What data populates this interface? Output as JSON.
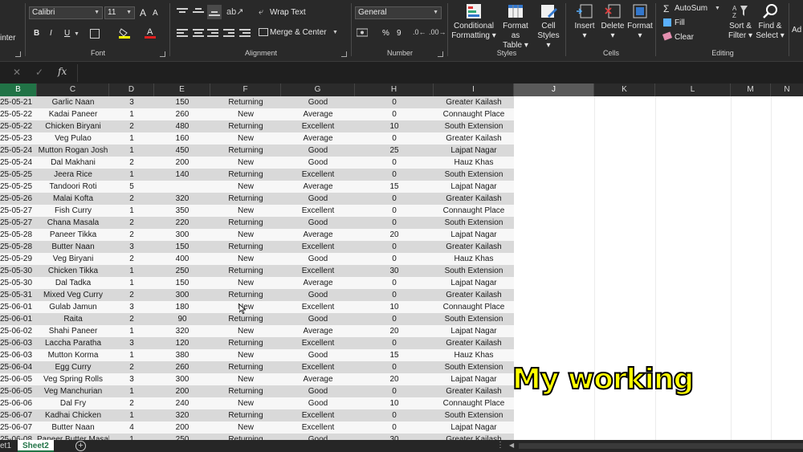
{
  "ribbon": {
    "clipboard_partial": "inter",
    "font": {
      "name": "Calibri",
      "size": "11",
      "grow_label": "A",
      "shrink_label": "A",
      "bold": "B",
      "italic": "I",
      "underline": "U",
      "group_label": "Font"
    },
    "alignment": {
      "wrap_text": "Wrap Text",
      "merge_center": "Merge & Center",
      "group_label": "Alignment"
    },
    "number": {
      "format": "General",
      "percent": "%",
      "comma": "9",
      "group_label": "Number"
    },
    "styles": {
      "conditional_formatting": [
        "Conditional",
        "Formatting"
      ],
      "format_as_table": [
        "Format as",
        "Table"
      ],
      "cell_styles": [
        "Cell",
        "Styles"
      ],
      "group_label": "Styles"
    },
    "cells": {
      "insert": "Insert",
      "delete": "Delete",
      "format": "Format",
      "group_label": "Cells"
    },
    "editing": {
      "autosum": "AutoSum",
      "fill": "Fill",
      "clear": "Clear",
      "sort_filter": [
        "Sort &",
        "Filter"
      ],
      "find_select": [
        "Find &",
        "Select"
      ],
      "group_label": "Editing"
    },
    "addins_partial": "Ad"
  },
  "formula_bar": {
    "fx": "fx"
  },
  "columns": [
    "B",
    "C",
    "D",
    "E",
    "F",
    "G",
    "H",
    "I",
    "J",
    "K",
    "L",
    "M",
    "N"
  ],
  "rows": [
    [
      "25-05-21",
      "Garlic Naan",
      "3",
      "150",
      "Returning",
      "Good",
      "0",
      "Greater Kailash"
    ],
    [
      "25-05-22",
      "Kadai Paneer",
      "1",
      "260",
      "New",
      "Average",
      "0",
      "Connaught Place"
    ],
    [
      "25-05-22",
      "Chicken Biryani",
      "2",
      "480",
      "Returning",
      "Excellent",
      "10",
      "South Extension"
    ],
    [
      "25-05-23",
      "Veg Pulao",
      "1",
      "160",
      "New",
      "Average",
      "0",
      "Greater Kailash"
    ],
    [
      "25-05-24",
      "Mutton Rogan Josh",
      "1",
      "450",
      "Returning",
      "Good",
      "25",
      "Lajpat Nagar"
    ],
    [
      "25-05-24",
      "Dal Makhani",
      "2",
      "200",
      "New",
      "Good",
      "0",
      "Hauz Khas"
    ],
    [
      "25-05-25",
      "Jeera Rice",
      "1",
      "140",
      "Returning",
      "Excellent",
      "0",
      "South Extension"
    ],
    [
      "25-05-25",
      "Tandoori Roti",
      "5",
      "",
      "New",
      "Average",
      "15",
      "Lajpat Nagar"
    ],
    [
      "25-05-26",
      "Malai Kofta",
      "2",
      "320",
      "Returning",
      "Good",
      "0",
      "Greater Kailash"
    ],
    [
      "25-05-27",
      "Fish Curry",
      "1",
      "350",
      "New",
      "Excellent",
      "0",
      "Connaught Place"
    ],
    [
      "25-05-27",
      "Chana Masala",
      "2",
      "220",
      "Returning",
      "Good",
      "0",
      "South Extension"
    ],
    [
      "25-05-28",
      "Paneer Tikka",
      "2",
      "300",
      "New",
      "Average",
      "20",
      "Lajpat Nagar"
    ],
    [
      "25-05-28",
      "Butter Naan",
      "3",
      "150",
      "Returning",
      "Excellent",
      "0",
      "Greater Kailash"
    ],
    [
      "25-05-29",
      "Veg Biryani",
      "2",
      "400",
      "New",
      "Good",
      "0",
      "Hauz Khas"
    ],
    [
      "25-05-30",
      "Chicken Tikka",
      "1",
      "250",
      "Returning",
      "Excellent",
      "30",
      "South Extension"
    ],
    [
      "25-05-30",
      "Dal Tadka",
      "1",
      "150",
      "New",
      "Average",
      "0",
      "Lajpat Nagar"
    ],
    [
      "25-05-31",
      "Mixed Veg Curry",
      "2",
      "300",
      "Returning",
      "Good",
      "0",
      "Greater Kailash"
    ],
    [
      "25-06-01",
      "Gulab Jamun",
      "3",
      "180",
      "New",
      "Excellent",
      "10",
      "Connaught Place"
    ],
    [
      "25-06-01",
      "Raita",
      "2",
      "90",
      "Returning",
      "Good",
      "0",
      "South Extension"
    ],
    [
      "25-06-02",
      "Shahi Paneer",
      "1",
      "320",
      "New",
      "Average",
      "20",
      "Lajpat Nagar"
    ],
    [
      "25-06-03",
      "Laccha Paratha",
      "3",
      "120",
      "Returning",
      "Excellent",
      "0",
      "Greater Kailash"
    ],
    [
      "25-06-03",
      "Mutton Korma",
      "1",
      "380",
      "New",
      "Good",
      "15",
      "Hauz Khas"
    ],
    [
      "25-06-04",
      "Egg Curry",
      "2",
      "260",
      "Returning",
      "Excellent",
      "0",
      "South Extension"
    ],
    [
      "25-06-05",
      "Veg Spring Rolls",
      "3",
      "300",
      "New",
      "Average",
      "20",
      "Lajpat Nagar"
    ],
    [
      "25-06-05",
      "Veg Manchurian",
      "1",
      "200",
      "Returning",
      "Good",
      "0",
      "Greater Kailash"
    ],
    [
      "25-06-06",
      "Dal Fry",
      "2",
      "240",
      "New",
      "Good",
      "10",
      "Connaught Place"
    ],
    [
      "25-06-07",
      "Kadhai Chicken",
      "1",
      "320",
      "Returning",
      "Excellent",
      "0",
      "South Extension"
    ],
    [
      "25-06-07",
      "Butter Naan",
      "4",
      "200",
      "New",
      "Excellent",
      "0",
      "Lajpat Nagar"
    ],
    [
      "25-06-08",
      "Paneer Butter Masal",
      "1",
      "250",
      "Returning",
      "Good",
      "30",
      "Greater Kailash"
    ]
  ],
  "sheet_tabs": {
    "partial": "et1",
    "active": "Sheet2"
  },
  "overlay_caption": "My working",
  "colors": {
    "ribbon_bg": "#292929",
    "accent_green": "#217346",
    "row_gray": "#d9d9d9",
    "caption_yellow": "#ffff00"
  }
}
